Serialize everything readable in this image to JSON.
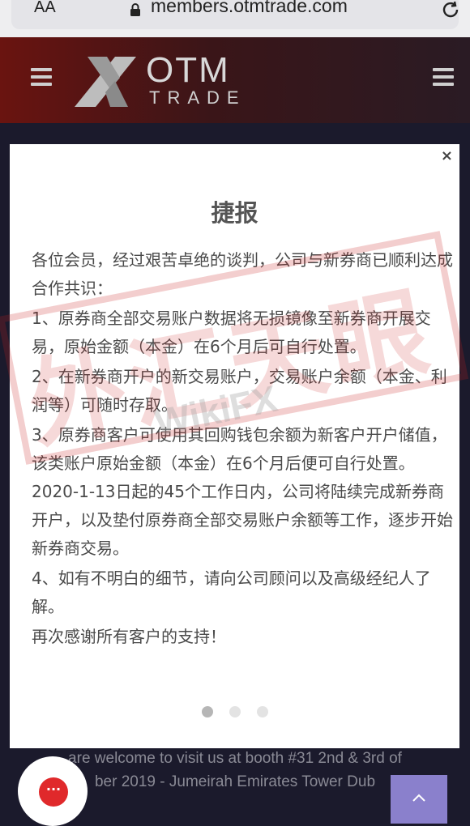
{
  "browser": {
    "text_size_label": "AA",
    "url": "members.otmtrade.com"
  },
  "header": {
    "logo_main": "OTM",
    "logo_sub": "TRADE"
  },
  "modal": {
    "close_label": "×",
    "title": "捷报",
    "paragraphs": [
      "各位会员，经过艰苦卓绝的谈判，公司与新券商已顺利达成合作共识：",
      "1、原券商全部交易账户数据将无损镜像至新券商开展交易，原始金额（本金）在6个月后可自行处置。",
      "2、在新券商开户的新交易账户，交易账户余额（本金、利润等）可随时存取。",
      "3、原券商客户可使用其回购钱包余额为新客户开户储值，该类账户原始金额（本金）在6个月后便可自行处置。2020-1-13日起的45个工作日内，公司将陆续完成新券商开户，以及垫付原券商全部交易账户余额等工作，逐步开始新券商交易。",
      "4、如有不明白的细节，请向公司顾问以及高级经纪人了解。",
      "再次感谢所有客户的支持！"
    ],
    "carousel": {
      "total": 3,
      "active": 1
    }
  },
  "watermark": {
    "stamp_text": "外汇天眼",
    "brand": "WikiFX"
  },
  "footer": {
    "line1": "are welcome to visit us at booth #31 2nd & 3rd of",
    "line2": "ber 2019 - Jumeirah Emirates Tower Dub"
  },
  "chat": {
    "label": "···"
  },
  "colors": {
    "header_left": "#6a1410",
    "page_bg": "#1b1a2c",
    "chat_red": "#e0292b",
    "scroll_top_bg": "#8a80cc"
  }
}
